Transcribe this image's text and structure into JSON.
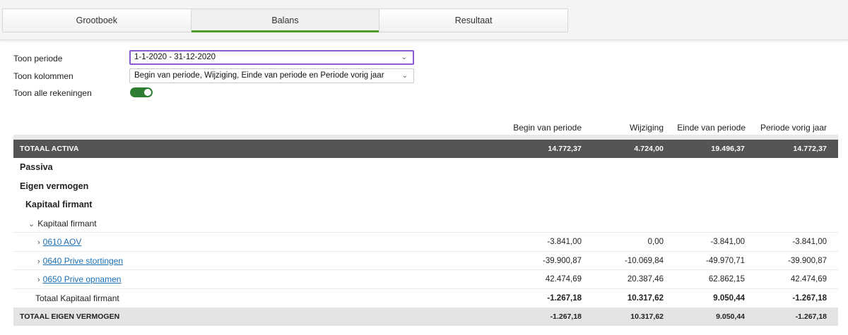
{
  "tabs": [
    {
      "label": "Grootboek"
    },
    {
      "label": "Balans"
    },
    {
      "label": "Resultaat"
    }
  ],
  "filters": {
    "periode_label": "Toon periode",
    "periode_value": "1-1-2020 - 31-12-2020",
    "kolommen_label": "Toon kolommen",
    "kolommen_value": "Begin van periode, Wijziging, Einde van periode en Periode vorig jaar",
    "alle_rekeningen_label": "Toon alle rekeningen",
    "alle_rekeningen_on": true
  },
  "columns": [
    "Begin van periode",
    "Wijziging",
    "Einde van periode",
    "Periode vorig jaar"
  ],
  "colors": {
    "accent": "#4c9a2a",
    "toggle": "#2e7d32",
    "focus": "#8a5bd6",
    "header_row": "#555555",
    "link": "#1a6fb5"
  },
  "rows": {
    "totaal_activa": {
      "label": "TOTAAL ACTIVA",
      "values": [
        "14.772,37",
        "4.724,00",
        "19.496,37",
        "14.772,37"
      ]
    },
    "passiva": {
      "label": "Passiva"
    },
    "eigen_vermogen": {
      "label": "Eigen vermogen"
    },
    "kapitaal_firmant_h": {
      "label": "Kapitaal firmant"
    },
    "kapitaal_firmant_group": {
      "label": "Kapitaal firmant"
    },
    "aov": {
      "label": "0610 AOV",
      "values": [
        "-3.841,00",
        "0,00",
        "-3.841,00",
        "-3.841,00"
      ]
    },
    "prive_stortingen": {
      "label": "0640 Prive stortingen",
      "values": [
        "-39.900,87",
        "-10.069,84",
        "-49.970,71",
        "-39.900,87"
      ]
    },
    "prive_opnamen": {
      "label": "0650 Prive opnamen",
      "values": [
        "42.474,69",
        "20.387,46",
        "62.862,15",
        "42.474,69"
      ]
    },
    "totaal_kapitaal": {
      "label": "Totaal Kapitaal firmant",
      "values": [
        "-1.267,18",
        "10.317,62",
        "9.050,44",
        "-1.267,18"
      ]
    },
    "totaal_eigen_vermogen": {
      "label": "TOTAAL EIGEN VERMOGEN",
      "values": [
        "-1.267,18",
        "10.317,62",
        "9.050,44",
        "-1.267,18"
      ]
    }
  }
}
